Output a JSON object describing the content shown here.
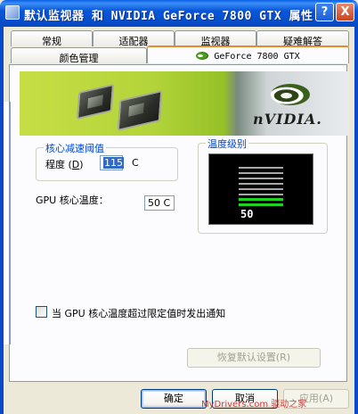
{
  "window": {
    "title": "默认监视器 和 NVIDIA GeForce 7800 GTX 属性",
    "help_glyph": "?",
    "close_glyph": "X"
  },
  "tabs_row1": [
    {
      "label": "常规"
    },
    {
      "label": "适配器"
    },
    {
      "label": "监视器"
    },
    {
      "label": "疑难解答"
    }
  ],
  "tabs_row2": [
    {
      "label": "颜色管理"
    },
    {
      "label": "GeForce 7800 GTX",
      "active": true
    }
  ],
  "banner": {
    "brand": "nVIDIA."
  },
  "slowdown_group": {
    "title": "核心减速阈值",
    "degree_label_pre": "程度 (",
    "degree_label_key": "D",
    "degree_label_post": ")",
    "value": "115",
    "unit": "C"
  },
  "core_temp": {
    "label": "GPU 核心温度：",
    "value": "50 C"
  },
  "temp_level_group": {
    "title": "温度级别",
    "display_value": "50",
    "bars_total": 8,
    "bars_lit": 2,
    "lit_color": "#21d321"
  },
  "notify_checkbox": {
    "label": "当 GPU 核心温度超过限定值时发出通知",
    "checked": false
  },
  "buttons": {
    "restore_defaults": "恢复默认设置(R)",
    "ok": "确定",
    "cancel": "取消",
    "apply": "应用(A)"
  },
  "watermark": "MyDrivers.com 驱动之家"
}
